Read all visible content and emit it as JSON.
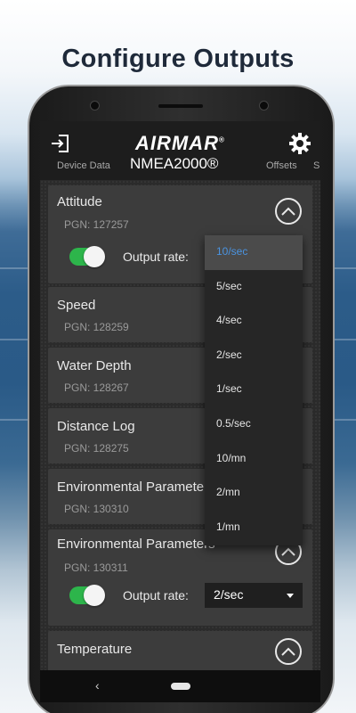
{
  "headline": "Configure Outputs",
  "app": {
    "brand": "AIRMAR",
    "brand_mark": "®",
    "exit_icon": "exit-icon",
    "settings_icon": "gear-icon"
  },
  "tabs": [
    {
      "label": "Device Data"
    },
    {
      "label": "NMEA2000®"
    },
    {
      "label": "Offsets"
    },
    {
      "label": "S"
    }
  ],
  "cards": [
    {
      "title": "Attitude",
      "pgn": "PGN: 127257",
      "output_label": "Output rate:",
      "output_value": "10/sec",
      "enabled": true
    },
    {
      "title": "Speed",
      "pgn": "PGN: 128259"
    },
    {
      "title": "Water Depth",
      "pgn": "PGN: 128267"
    },
    {
      "title": "Distance Log",
      "pgn": "PGN: 128275"
    },
    {
      "title": "Environmental Parameters",
      "pgn": "PGN: 130310"
    },
    {
      "title": "Environmental Parameters",
      "pgn": "PGN: 130311",
      "output_label": "Output rate:",
      "output_value": "2/sec",
      "enabled": true
    },
    {
      "title": "Temperature"
    }
  ],
  "dropdown": {
    "selected": "10/sec",
    "options": [
      "10/sec",
      "5/sec",
      "4/sec",
      "2/sec",
      "1/sec",
      "0.5/sec",
      "10/mn",
      "2/mn",
      "1/mn"
    ]
  },
  "nav": {
    "back_symbol": "‹"
  },
  "colors": {
    "toggle_on": "#2db54b",
    "selected_text": "#4a93e0",
    "screen_bg": "#1d1d1d"
  }
}
